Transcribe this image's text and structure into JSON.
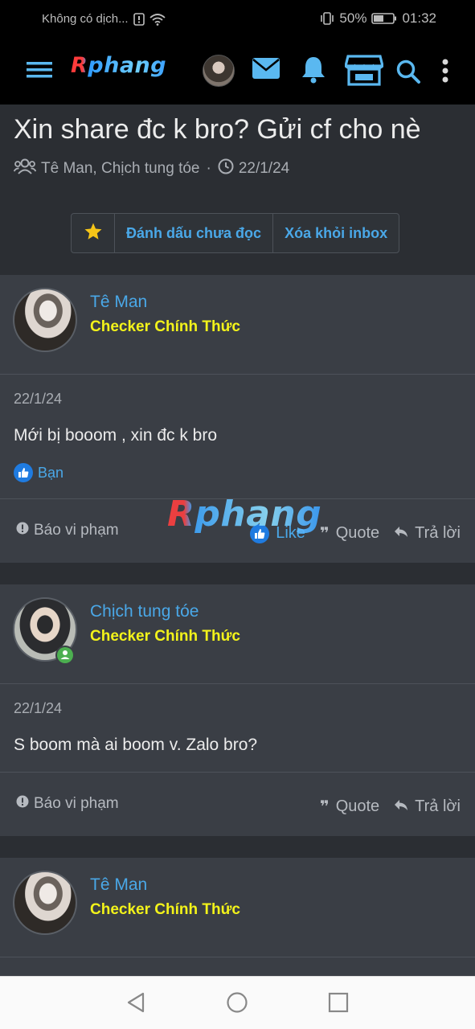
{
  "status_bar": {
    "carrier": "Không có dịch...",
    "battery": "50%",
    "time": "01:32"
  },
  "nav": {
    "logo": "Rphang",
    "icons": [
      "menu-icon",
      "avatar",
      "mail-icon",
      "bell-icon",
      "store-icon",
      "search-icon",
      "more-vertical-icon"
    ]
  },
  "thread": {
    "title": "Xin share đc k bro? Gửi cf cho nè",
    "participants": "Tê Man, Chịch tung tóe",
    "separator": "·",
    "date": "22/1/24",
    "actions": {
      "mark_unread": "Đánh dấu chưa đọc",
      "remove_inbox": "Xóa khỏi inbox"
    }
  },
  "watermark": "Rphang",
  "posts": [
    {
      "author": "Tê Man",
      "role": "Checker Chính Thức",
      "date": "22/1/24",
      "text": "Mới bị booom , xin đc k bro",
      "reaction": "Bạn",
      "report": "Báo vi phạm",
      "like": "Like",
      "quote": "Quote",
      "reply": "Trả lời"
    },
    {
      "author": "Chịch tung tóe",
      "role": "Checker Chính Thức",
      "date": "22/1/24",
      "text": "S boom mà ai boom v. Zalo bro?",
      "report": "Báo vi phạm",
      "quote": "Quote",
      "reply": "Trả lời"
    },
    {
      "author": "Tê Man",
      "role": "Checker Chính Thức"
    }
  ],
  "colors": {
    "accent": "#4aa8e8",
    "role": "#f3f31a",
    "background": "#2b2e33",
    "card": "#3a3e45"
  }
}
